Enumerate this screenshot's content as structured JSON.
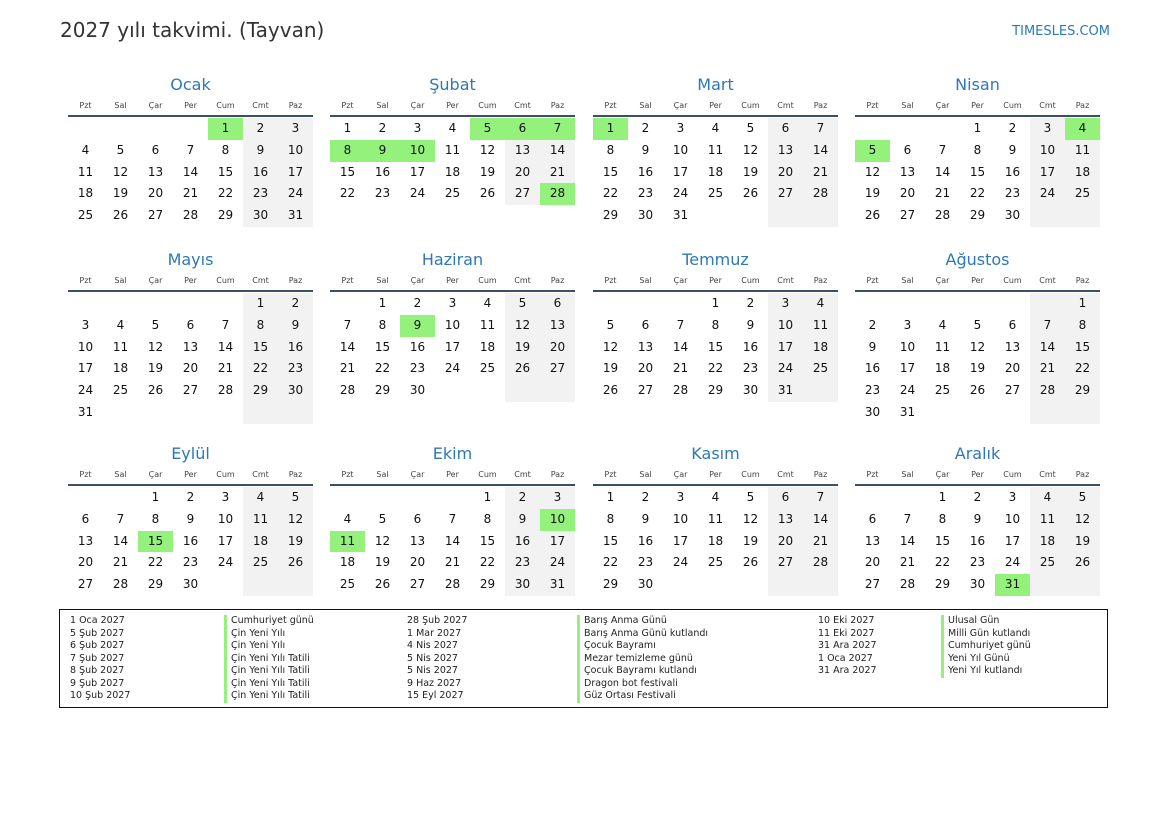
{
  "header": {
    "title": "2027 yılı takvimi. (Tayvan)",
    "site": "TIMESLES.COM"
  },
  "weekdays": [
    "Pzt",
    "Sal",
    "Çar",
    "Per",
    "Cum",
    "Cmt",
    "Paz"
  ],
  "months": [
    {
      "name": "Ocak",
      "offset": 4,
      "days": 31,
      "holidays": [
        1
      ]
    },
    {
      "name": "Şubat",
      "offset": 0,
      "days": 28,
      "holidays": [
        5,
        6,
        7,
        8,
        9,
        10,
        28
      ]
    },
    {
      "name": "Mart",
      "offset": 0,
      "days": 31,
      "holidays": [
        1
      ]
    },
    {
      "name": "Nisan",
      "offset": 3,
      "days": 30,
      "holidays": [
        4,
        5
      ]
    },
    {
      "name": "Mayıs",
      "offset": 5,
      "days": 31,
      "holidays": []
    },
    {
      "name": "Haziran",
      "offset": 1,
      "days": 30,
      "holidays": [
        9
      ]
    },
    {
      "name": "Temmuz",
      "offset": 3,
      "days": 31,
      "holidays": []
    },
    {
      "name": "Ağustos",
      "offset": 6,
      "days": 31,
      "holidays": []
    },
    {
      "name": "Eylül",
      "offset": 2,
      "days": 30,
      "holidays": [
        15
      ]
    },
    {
      "name": "Ekim",
      "offset": 4,
      "days": 31,
      "holidays": [
        10,
        11
      ]
    },
    {
      "name": "Kasım",
      "offset": 0,
      "days": 30,
      "holidays": []
    },
    {
      "name": "Aralık",
      "offset": 2,
      "days": 31,
      "holidays": [
        31
      ]
    }
  ],
  "holiday_list": [
    {
      "date": "1 Oca 2027",
      "name": "Cumhuriyet günü"
    },
    {
      "date": "5 Şub 2027",
      "name": "Çin Yeni Yılı"
    },
    {
      "date": "6 Şub 2027",
      "name": "Çin Yeni Yılı"
    },
    {
      "date": "7 Şub 2027",
      "name": "Çin Yeni Yılı Tatili"
    },
    {
      "date": "8 Şub 2027",
      "name": "Çin Yeni Yılı Tatili"
    },
    {
      "date": "9 Şub 2027",
      "name": "Çin Yeni Yılı Tatili"
    },
    {
      "date": "10 Şub 2027",
      "name": "Çin Yeni Yılı Tatili"
    },
    {
      "date": "28 Şub 2027",
      "name": "Barış Anma Günü"
    },
    {
      "date": "1 Mar 2027",
      "name": "Barış Anma Günü kutlandı"
    },
    {
      "date": "4 Nis 2027",
      "name": "Çocuk Bayramı"
    },
    {
      "date": "5 Nis 2027",
      "name": "Mezar temizleme günü"
    },
    {
      "date": "5 Nis 2027",
      "name": "Çocuk Bayramı kutlandı"
    },
    {
      "date": "9 Haz 2027",
      "name": "Dragon bot festivali"
    },
    {
      "date": "15 Eyl 2027",
      "name": "Güz Ortası Festivali"
    },
    {
      "date": "10 Eki 2027",
      "name": "Ulusal Gün"
    },
    {
      "date": "11 Eki 2027",
      "name": "Milli Gün kutlandı"
    },
    {
      "date": "31 Ara 2027",
      "name": "Cumhuriyet günü"
    },
    {
      "date": "1 Oca 2027",
      "name": "Yeni Yıl Günü"
    },
    {
      "date": "31 Ara 2027",
      "name": "Yeni Yıl kutlandı"
    }
  ]
}
